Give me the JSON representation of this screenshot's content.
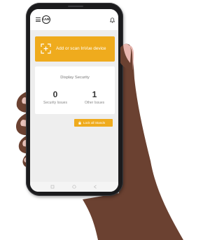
{
  "colors": {
    "accent": "#efab1d",
    "screen_bg": "#eeeeee",
    "card_bg": "#ffffff",
    "phone_body": "#1b1b1d",
    "skin": "#6b4131"
  },
  "header": {
    "logo_text": "LIVE",
    "menu_icon": "hamburger-menu-icon",
    "notification_icon": "bell-icon"
  },
  "scan_card": {
    "label": "Add or scan InVue device",
    "icon": "scan-plus-icon"
  },
  "security_card": {
    "title": "Display Security",
    "stats": [
      {
        "value": "0",
        "label": "Security Issues"
      },
      {
        "value": "1",
        "label": "Other Issues"
      }
    ]
  },
  "lock_button": {
    "label": "Lock all Stands",
    "icon": "lock-icon"
  },
  "navbar": {
    "icons": [
      "recent-apps-icon",
      "home-icon",
      "back-icon"
    ]
  }
}
